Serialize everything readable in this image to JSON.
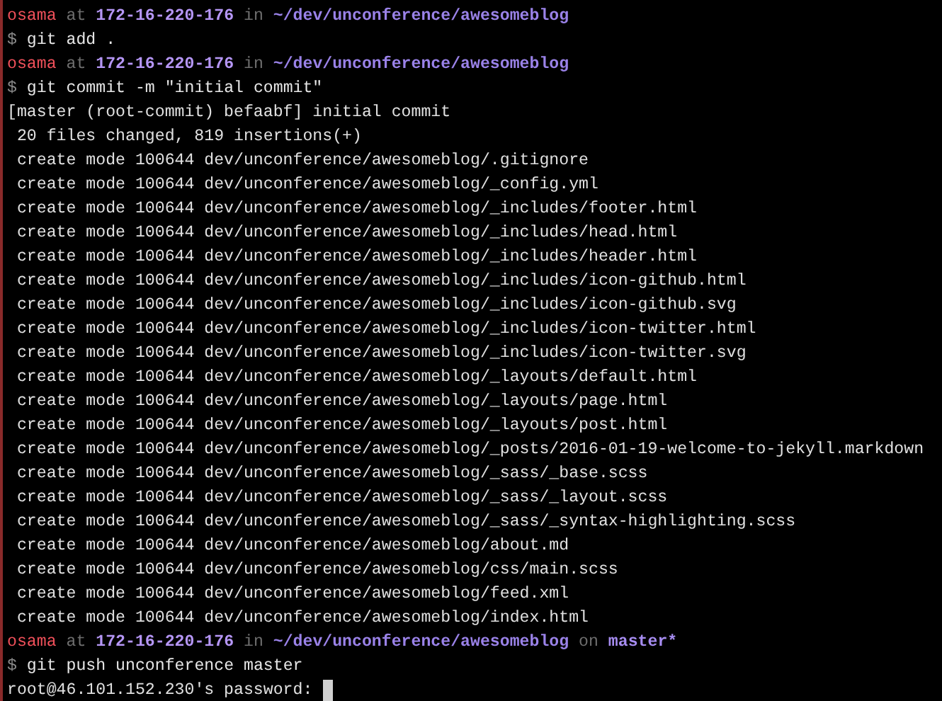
{
  "lines": [
    {
      "kind": "prompt",
      "segments": [
        {
          "kind": "user",
          "text": "osama"
        },
        {
          "kind": "muted",
          "text": "at"
        },
        {
          "kind": "host",
          "text": "172-16-220-176"
        },
        {
          "kind": "muted",
          "text": "in"
        },
        {
          "kind": "path",
          "text": "~/dev/unconference/awesomeblog"
        }
      ]
    },
    {
      "kind": "command",
      "segments": [
        {
          "kind": "sign",
          "text": "$"
        },
        {
          "kind": "text",
          "text": "git add ."
        }
      ]
    },
    {
      "kind": "prompt",
      "segments": [
        {
          "kind": "user",
          "text": "osama"
        },
        {
          "kind": "muted",
          "text": "at"
        },
        {
          "kind": "host",
          "text": "172-16-220-176"
        },
        {
          "kind": "muted",
          "text": "in"
        },
        {
          "kind": "path",
          "text": "~/dev/unconference/awesomeblog"
        }
      ]
    },
    {
      "kind": "command",
      "segments": [
        {
          "kind": "sign",
          "text": "$"
        },
        {
          "kind": "text",
          "text": "git commit -m \"initial commit\""
        }
      ]
    },
    {
      "kind": "output",
      "text": "[master (root-commit) befaabf] initial commit"
    },
    {
      "kind": "output",
      "indent": true,
      "text": "20 files changed, 819 insertions(+)"
    },
    {
      "kind": "output",
      "indent": true,
      "text": "create mode 100644 dev/unconference/awesomeblog/.gitignore"
    },
    {
      "kind": "output",
      "indent": true,
      "text": "create mode 100644 dev/unconference/awesomeblog/_config.yml"
    },
    {
      "kind": "output",
      "indent": true,
      "text": "create mode 100644 dev/unconference/awesomeblog/_includes/footer.html"
    },
    {
      "kind": "output",
      "indent": true,
      "text": "create mode 100644 dev/unconference/awesomeblog/_includes/head.html"
    },
    {
      "kind": "output",
      "indent": true,
      "text": "create mode 100644 dev/unconference/awesomeblog/_includes/header.html"
    },
    {
      "kind": "output",
      "indent": true,
      "text": "create mode 100644 dev/unconference/awesomeblog/_includes/icon-github.html"
    },
    {
      "kind": "output",
      "indent": true,
      "text": "create mode 100644 dev/unconference/awesomeblog/_includes/icon-github.svg"
    },
    {
      "kind": "output",
      "indent": true,
      "text": "create mode 100644 dev/unconference/awesomeblog/_includes/icon-twitter.html"
    },
    {
      "kind": "output",
      "indent": true,
      "text": "create mode 100644 dev/unconference/awesomeblog/_includes/icon-twitter.svg"
    },
    {
      "kind": "output",
      "indent": true,
      "text": "create mode 100644 dev/unconference/awesomeblog/_layouts/default.html"
    },
    {
      "kind": "output",
      "indent": true,
      "text": "create mode 100644 dev/unconference/awesomeblog/_layouts/page.html"
    },
    {
      "kind": "output",
      "indent": true,
      "text": "create mode 100644 dev/unconference/awesomeblog/_layouts/post.html"
    },
    {
      "kind": "output",
      "indent": true,
      "text": "create mode 100644 dev/unconference/awesomeblog/_posts/2016-01-19-welcome-to-jekyll.markdown"
    },
    {
      "kind": "output",
      "indent": true,
      "text": "create mode 100644 dev/unconference/awesomeblog/_sass/_base.scss"
    },
    {
      "kind": "output",
      "indent": true,
      "text": "create mode 100644 dev/unconference/awesomeblog/_sass/_layout.scss"
    },
    {
      "kind": "output",
      "indent": true,
      "text": "create mode 100644 dev/unconference/awesomeblog/_sass/_syntax-highlighting.scss"
    },
    {
      "kind": "output",
      "indent": true,
      "text": "create mode 100644 dev/unconference/awesomeblog/about.md"
    },
    {
      "kind": "output",
      "indent": true,
      "text": "create mode 100644 dev/unconference/awesomeblog/css/main.scss"
    },
    {
      "kind": "output",
      "indent": true,
      "text": "create mode 100644 dev/unconference/awesomeblog/feed.xml"
    },
    {
      "kind": "output",
      "indent": true,
      "text": "create mode 100644 dev/unconference/awesomeblog/index.html"
    },
    {
      "kind": "prompt",
      "segments": [
        {
          "kind": "user",
          "text": "osama"
        },
        {
          "kind": "muted",
          "text": "at"
        },
        {
          "kind": "host",
          "text": "172-16-220-176"
        },
        {
          "kind": "muted",
          "text": "in"
        },
        {
          "kind": "path",
          "text": "~/dev/unconference/awesomeblog"
        },
        {
          "kind": "muted",
          "text": "on"
        },
        {
          "kind": "branch",
          "text": "master*"
        }
      ]
    },
    {
      "kind": "command",
      "segments": [
        {
          "kind": "sign",
          "text": "$"
        },
        {
          "kind": "text",
          "text": "git push unconference master"
        }
      ]
    },
    {
      "kind": "output",
      "text": "root@46.101.152.230's password:",
      "cursor": true
    }
  ]
}
